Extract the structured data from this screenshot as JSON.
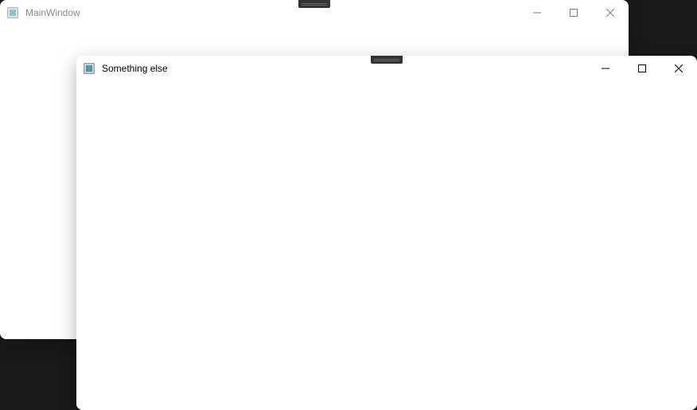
{
  "windows": [
    {
      "title": "MainWindow",
      "active": false
    },
    {
      "title": "Something else",
      "active": true
    }
  ]
}
